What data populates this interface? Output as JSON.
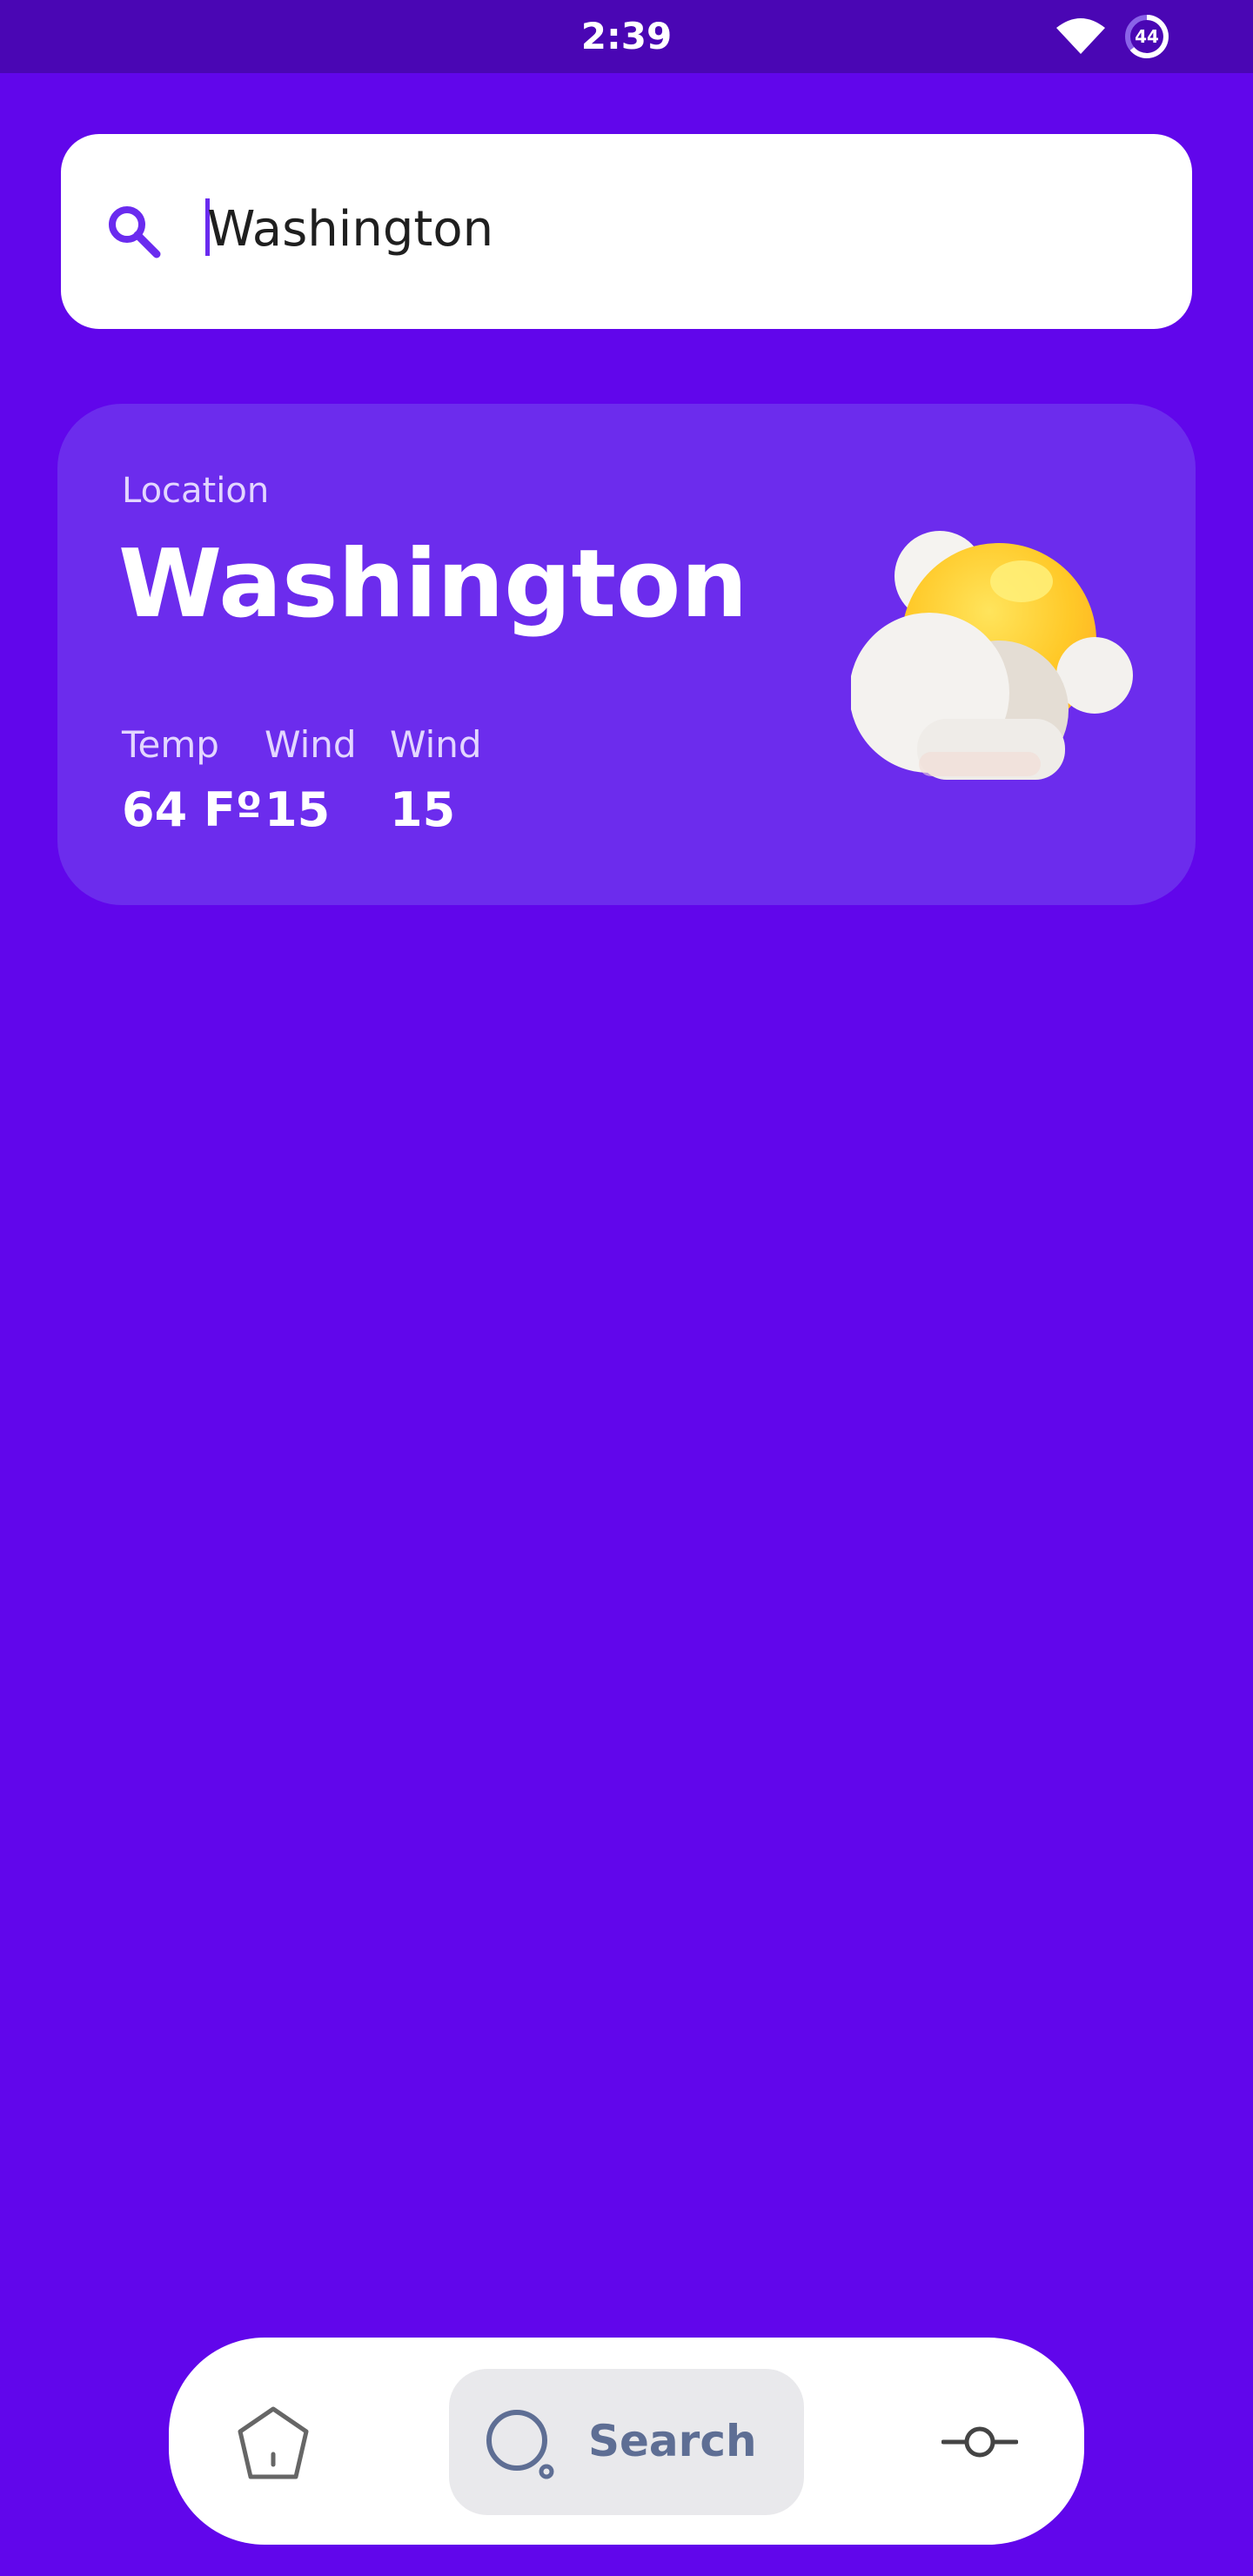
{
  "status_bar": {
    "time": "2:39",
    "battery_level": "44",
    "wifi_icon": "wifi-icon",
    "battery_icon": "battery-icon"
  },
  "search": {
    "value": "Washington",
    "icon": "search-icon"
  },
  "weather_card": {
    "location_label": "Location",
    "city": "Washington",
    "stats": [
      {
        "label": "Temp",
        "value": "64 Fº"
      },
      {
        "label": "Wind",
        "value": "15"
      },
      {
        "label": "Wind",
        "value": "15"
      }
    ],
    "condition_icon": "partly-cloudy-icon"
  },
  "bottom_nav": {
    "items": [
      {
        "icon": "home-icon",
        "label": ""
      },
      {
        "icon": "search-icon",
        "label": "Search",
        "active": true
      },
      {
        "icon": "commit-icon",
        "label": ""
      }
    ]
  },
  "colors": {
    "background": "#6106EB",
    "status_bar": "#4A06B4",
    "card": "#6C2CED",
    "accent": "#6A2BEF",
    "nav_active_bg": "#E9E9EC",
    "nav_icon": "#5E6E94"
  }
}
